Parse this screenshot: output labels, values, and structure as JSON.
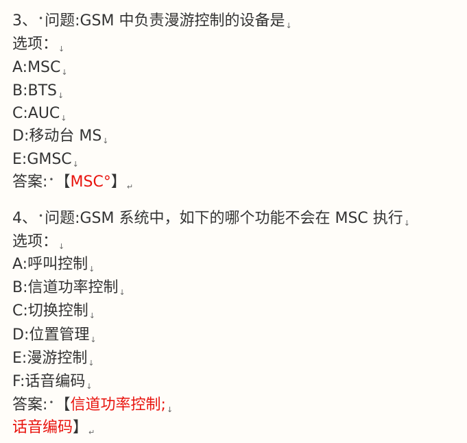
{
  "questions": [
    {
      "number": "3、",
      "question": "问题:GSM 中负责漫游控制的设备是",
      "options_label": "选项：",
      "options": [
        "A:MSC",
        "B:BTS",
        "C:AUC",
        "D:移动台 MS",
        "E:GMSC"
      ],
      "answer_label": "答案:",
      "answer_open": "【",
      "answer": "MSC°",
      "answer_close": "】"
    },
    {
      "number": "4、",
      "question": "问题:GSM 系统中，如下的哪个功能不会在 MSC 执行",
      "options_label": "选项：",
      "options": [
        "A:呼叫控制",
        "B:信道功率控制",
        "C:切换控制",
        "D:位置管理",
        "E:漫游控制",
        "F:话音编码"
      ],
      "answer_label": "答案:",
      "answer_open": "【",
      "answer_line1": "信道功率控制;",
      "answer_line2": "话音编码",
      "answer_close": "】"
    }
  ],
  "glyphs": {
    "paragraph_mark": "↓",
    "return_mark": "↵",
    "dot": "•"
  }
}
